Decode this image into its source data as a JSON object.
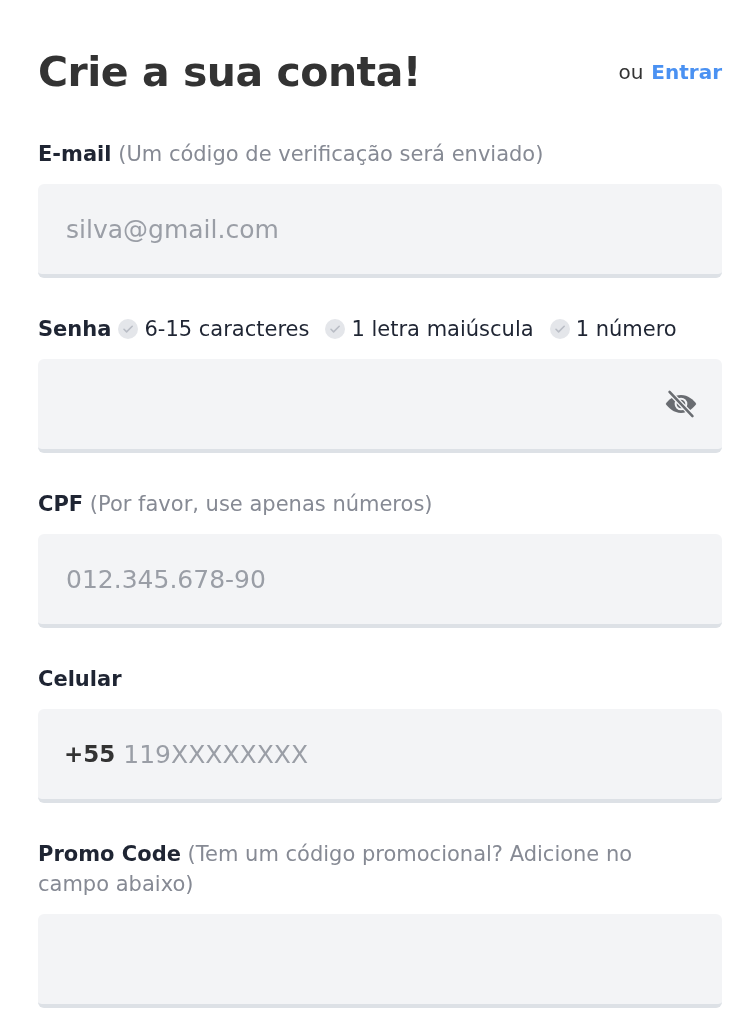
{
  "header": {
    "title": "Crie a sua conta!",
    "login_prompt": "ou",
    "login_link": "Entrar"
  },
  "fields": [
    {
      "kind": "text",
      "label": "E-mail",
      "hint": "(Um código de verificação será enviado)",
      "placeholder": "silva@gmail.com"
    },
    {
      "kind": "password",
      "label": "Senha",
      "requirements": [
        {
          "text": "6-15 caracteres",
          "met": false
        },
        {
          "text": "1 letra maiúscula",
          "met": false
        },
        {
          "text": "1 número",
          "met": false
        }
      ]
    },
    {
      "kind": "text",
      "label": "CPF",
      "hint": "(Por favor, use apenas números)",
      "placeholder": "012.345.678-90"
    },
    {
      "kind": "phone",
      "label": "Celular",
      "prefix": "+55",
      "placeholder": "119XXXXXXXX"
    },
    {
      "kind": "text",
      "label": "Promo Code",
      "hint": "(Tem um código promocional? Adicione no campo abaixo)"
    }
  ]
}
